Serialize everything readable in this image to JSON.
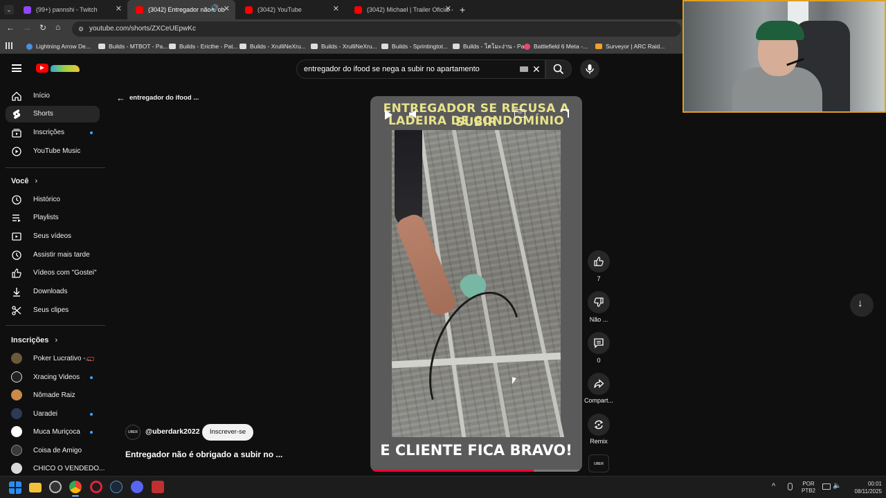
{
  "browser": {
    "tabs": [
      {
        "title": "(99+) pannshi - Twitch",
        "color": "#9146ff"
      },
      {
        "title": "(3042) Entregador não é ob",
        "color": "#ff0000"
      },
      {
        "title": "(3042) YouTube",
        "color": "#ff0000"
      },
      {
        "title": "(3042) Michael | Trailer Oficial -",
        "color": "#ff0000"
      }
    ],
    "url": "youtube.com/shorts/ZXCeUEpwKc",
    "bookmarks": [
      "Lightning Arrow De...",
      "Builds - MTBOT - Pa...",
      "Builds - Ericthe - Pat...",
      "Builds - XrulliNeXru...",
      "Builds - XrulliNeXru...",
      "Builds - Sprintingtot...",
      "Builds - โคโมะง่าน - Pa...",
      "Battlefield 6 Meta -...",
      "Surveyor | ARC Raid..."
    ]
  },
  "search": {
    "query": "entregador do ifood se nega a subir no apartamento"
  },
  "sidebar": {
    "items": [
      {
        "label": "Início",
        "icon": "home-icon"
      },
      {
        "label": "Shorts",
        "icon": "shorts-icon"
      },
      {
        "label": "Inscrições",
        "icon": "subscriptions-icon"
      },
      {
        "label": "YouTube Music",
        "icon": "music-icon"
      }
    ],
    "you_header": "Você",
    "you_items": [
      {
        "label": "Histórico",
        "icon": "history-icon"
      },
      {
        "label": "Playlists",
        "icon": "playlists-icon"
      },
      {
        "label": "Seus vídeos",
        "icon": "your-videos-icon"
      },
      {
        "label": "Assistir mais tarde",
        "icon": "watch-later-icon"
      },
      {
        "label": "Vídeos com \"Gostei\"",
        "icon": "liked-icon"
      },
      {
        "label": "Downloads",
        "icon": "download-icon"
      },
      {
        "label": "Seus clipes",
        "icon": "clips-icon"
      }
    ],
    "subs_header": "Inscrições",
    "subs": [
      {
        "label": "Poker Lucrativo -...",
        "color": "#6b5a3a"
      },
      {
        "label": "Xracing Videos",
        "color": "#222"
      },
      {
        "label": "Nômade Raiz",
        "color": "#c98a4a"
      },
      {
        "label": "Uaradei",
        "color": "#2b3a55"
      },
      {
        "label": "Muca Muriçoca",
        "color": "#ffffff"
      },
      {
        "label": "Coisa de Amigo",
        "color": "#3a3a3a"
      },
      {
        "label": "CHICO O VENDEDO...",
        "color": "#d9d9d9"
      }
    ]
  },
  "shorts": {
    "back_label": "entregador do ifood ...",
    "caption_top_1": "ENTREGADOR SE RECUSA A SUBIR",
    "caption_top_2": "LADEIRA DE CONDOMÍNIO",
    "caption_bottom": "E CLIENTE FICA BRAVO!",
    "channel": "@uberdark2022",
    "subscribe_label": "Inscrever-se",
    "title": "Entregador não é obrigado a subir no ...",
    "progress": 0.77,
    "actions": {
      "like_count": "7",
      "dislike_label": "Não ...",
      "comments_count": "0",
      "share_label": "Compart...",
      "remix_label": "Remix"
    }
  },
  "taskbar": {
    "lang": "POR",
    "layout": "PTB2",
    "time": "00:01",
    "date": "08/11/2025"
  }
}
